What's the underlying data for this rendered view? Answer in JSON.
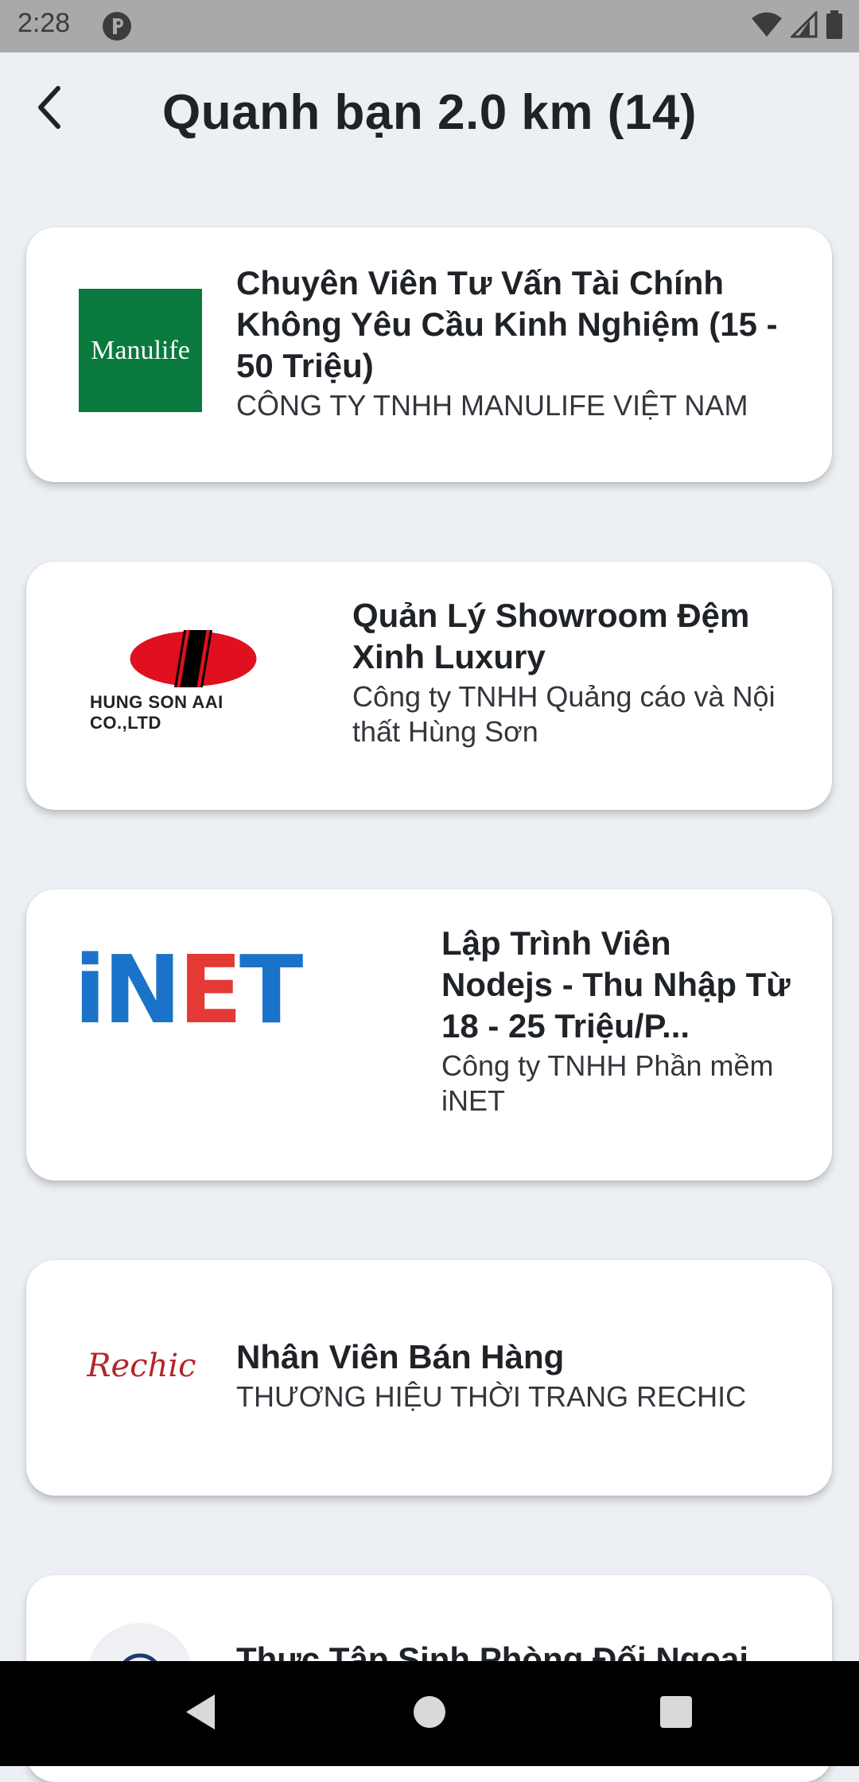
{
  "status_bar": {
    "time": "2:28",
    "icons": [
      "app-notification-icon",
      "wifi-icon",
      "cellular-signal-icon",
      "battery-icon"
    ]
  },
  "header": {
    "title": "Quanh bạn 2.0 km (14)",
    "back_icon": "chevron-left-icon"
  },
  "jobs": [
    {
      "title": "Chuyên Viên Tư Vấn  Tài Chính Không Yêu Cầu Kinh Nghiệm (15 - 50 Triệu)",
      "company": "CÔNG TY TNHH MANULIFE VIỆT NAM",
      "logo_text": "Manulife",
      "logo_color": "#0A7A3E"
    },
    {
      "title": "Quản Lý Showroom Đệm Xinh Luxury",
      "company": "Công ty TNHH Quảng cáo và Nội thất Hùng Sơn",
      "logo_text": "HUNG SON AAI CO.,LTD",
      "logo_color": "#E0101E"
    },
    {
      "title": "Lập Trình Viên Nodejs  - Thu Nhập Từ 18 - 25 Triệu/P...",
      "company": "Công ty TNHH Phần mềm iNET",
      "logo_text_blue_1": "iN",
      "logo_text_red": "E",
      "logo_text_blue_2": "T",
      "logo_color_blue": "#1A73C8",
      "logo_color_red": "#E53935"
    },
    {
      "title": "Nhân Viên Bán Hàng",
      "company": "THƯƠNG HIỆU THỜI TRANG RECHIC",
      "logo_text": "Rechic",
      "logo_color": "#B5252A"
    },
    {
      "title": "Thực Tập Sinh  Phòng Đối Ngoại"
    }
  ],
  "nav_bar": {
    "icons": [
      "back-triangle-icon",
      "home-circle-icon",
      "recents-square-icon"
    ]
  }
}
